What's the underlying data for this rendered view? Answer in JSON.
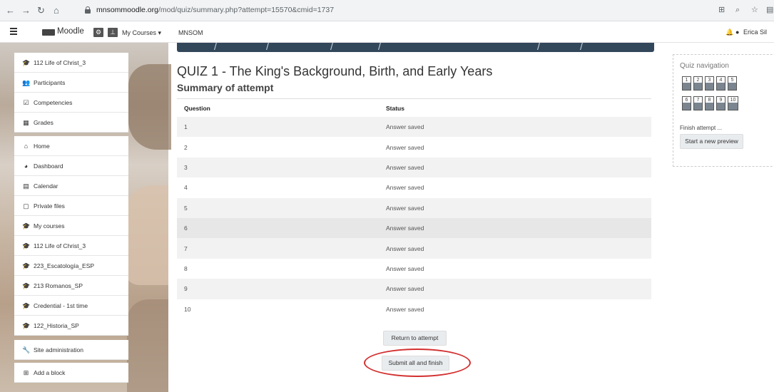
{
  "browser": {
    "url_host": "mnsommoodle.org",
    "url_path": "/mod/quiz/summary.php?attempt=15570&cmid=1737"
  },
  "navbar": {
    "brand": "Moodle",
    "my_courses": "My Courses",
    "site": "MNSOM",
    "user": "Erica Sil"
  },
  "drawer": {
    "items": [
      {
        "icon": "graduation-cap-icon",
        "label": "112 Life of Christ_3"
      },
      {
        "icon": "users-icon",
        "label": "Participants"
      },
      {
        "icon": "check-square-icon",
        "label": "Competencies"
      },
      {
        "icon": "table-icon",
        "label": "Grades"
      },
      {
        "icon": "home-icon",
        "label": "Home"
      },
      {
        "icon": "dashboard-icon",
        "label": "Dashboard"
      },
      {
        "icon": "calendar-icon",
        "label": "Calendar"
      },
      {
        "icon": "file-icon",
        "label": "Private files"
      },
      {
        "icon": "graduation-cap-icon",
        "label": "My courses"
      },
      {
        "icon": "graduation-cap-icon",
        "label": "112 Life of Christ_3"
      },
      {
        "icon": "graduation-cap-icon",
        "label": "223_Escatología_ESP"
      },
      {
        "icon": "graduation-cap-icon",
        "label": "213 Romanos_SP"
      },
      {
        "icon": "graduation-cap-icon",
        "label": "Credential - 1st time"
      },
      {
        "icon": "graduation-cap-icon",
        "label": "122_Historia_SP"
      },
      {
        "icon": "wrench-icon",
        "label": "Site administration"
      },
      {
        "icon": "plus-square-icon",
        "label": "Add a block"
      }
    ]
  },
  "main": {
    "title": "QUIZ 1 - The King's Background, Birth, and Early Years",
    "subtitle": "Summary of attempt",
    "table": {
      "headers": [
        "Question",
        "Status"
      ],
      "rows": [
        [
          "1",
          "Answer saved"
        ],
        [
          "2",
          "Answer saved"
        ],
        [
          "3",
          "Answer saved"
        ],
        [
          "4",
          "Answer saved"
        ],
        [
          "5",
          "Answer saved"
        ],
        [
          "6",
          "Answer saved"
        ],
        [
          "7",
          "Answer saved"
        ],
        [
          "8",
          "Answer saved"
        ],
        [
          "9",
          "Answer saved"
        ],
        [
          "10",
          "Answer saved"
        ]
      ]
    },
    "return_button": "Return to attempt",
    "submit_button": "Submit all and finish"
  },
  "quiz_nav": {
    "title": "Quiz navigation",
    "questions": [
      "1",
      "2",
      "3",
      "4",
      "5",
      "6",
      "7",
      "8",
      "9",
      "10"
    ],
    "finish_link": "Finish attempt ...",
    "preview_button": "Start a new preview"
  },
  "colors": {
    "accent_ring": "#d32f2f",
    "breadcrumb_bg": "#33475b"
  }
}
